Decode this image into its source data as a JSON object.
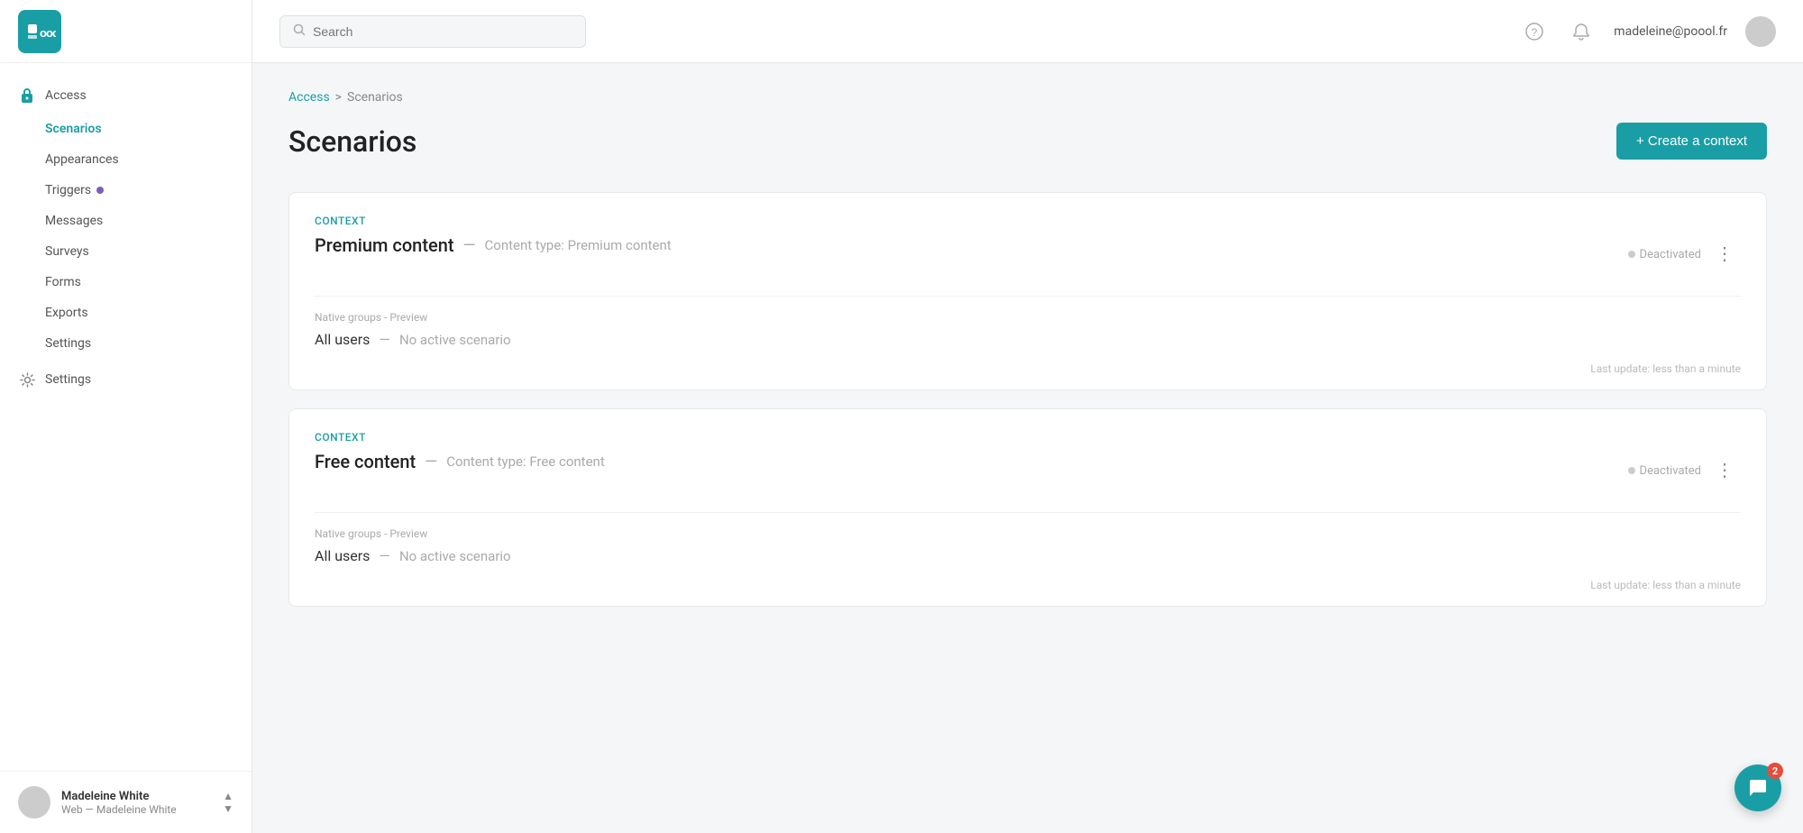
{
  "logo": {
    "text": "poool"
  },
  "sidebar": {
    "access_section": {
      "label": "Access",
      "items": [
        {
          "id": "scenarios",
          "label": "Scenarios",
          "active": true
        },
        {
          "id": "appearances",
          "label": "Appearances",
          "active": false
        },
        {
          "id": "triggers",
          "label": "Triggers",
          "active": false,
          "badge": true
        },
        {
          "id": "messages",
          "label": "Messages",
          "active": false
        },
        {
          "id": "surveys",
          "label": "Surveys",
          "active": false
        },
        {
          "id": "forms",
          "label": "Forms",
          "active": false
        },
        {
          "id": "exports",
          "label": "Exports",
          "active": false
        },
        {
          "id": "settings_sub",
          "label": "Settings",
          "active": false
        }
      ]
    },
    "settings": {
      "label": "Settings"
    },
    "user": {
      "name": "Madeleine White",
      "sub": "Web — Madeleine White"
    }
  },
  "topbar": {
    "search_placeholder": "Search",
    "user_email": "madeleine@poool.fr",
    "help_icon": "?",
    "bell_icon": "🔔"
  },
  "breadcrumb": {
    "access": "Access",
    "separator": ">",
    "current": "Scenarios"
  },
  "page": {
    "title": "Scenarios",
    "create_button": "+ Create a context"
  },
  "cards": [
    {
      "id": "card1",
      "context_label": "Context",
      "name": "Premium content",
      "dash": "—",
      "subtitle": "Content type: Premium content",
      "status": "Deactivated",
      "groups_label": "Native groups - Preview",
      "group_name": "All users",
      "group_dash": "—",
      "group_status": "No active scenario",
      "last_update": "Last update: less than a minute"
    },
    {
      "id": "card2",
      "context_label": "Context",
      "name": "Free content",
      "dash": "—",
      "subtitle": "Content type: Free content",
      "status": "Deactivated",
      "groups_label": "Native groups - Preview",
      "group_name": "All users",
      "group_dash": "—",
      "group_status": "No active scenario",
      "last_update": "Last update: less than a minute"
    }
  ],
  "chat": {
    "badge": "2"
  }
}
